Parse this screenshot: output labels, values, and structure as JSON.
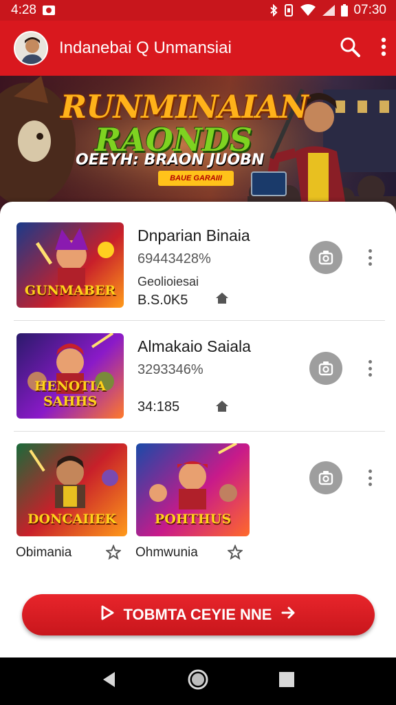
{
  "status_bar": {
    "time": "4:28",
    "clock": "07:30"
  },
  "app_bar": {
    "title": "Indanebai Q Unmansiai",
    "icons": [
      "avatar",
      "search-icon",
      "more-vert-icon"
    ]
  },
  "hero": {
    "title_line1": "RUNMINAIAN",
    "title_line2": "RAONDS",
    "subtitle": "OEEYH: BRAON JUOBN",
    "tag": "BAUE GARAIII"
  },
  "items": [
    {
      "thumb_label": "GUNMABER",
      "title": "Dnparian Binaia",
      "stat": "69443428%",
      "sub": "Geolioiesai",
      "size": "B.S.0K5"
    },
    {
      "thumb_label": "HENOTIA SAHHS",
      "title": "Almakaio Saiala",
      "stat": "3293346%",
      "size": "34:185"
    }
  ],
  "mini_games": [
    {
      "thumb_label": "DONCAIIEK",
      "label": "Obimania"
    },
    {
      "thumb_label": "POHTHUS",
      "label": "Ohmwunia"
    }
  ],
  "cta": {
    "label": "TOBMTA CEYIE NNE"
  },
  "colors": {
    "brand_red": "#d9181e",
    "status_red": "#c8161c"
  }
}
